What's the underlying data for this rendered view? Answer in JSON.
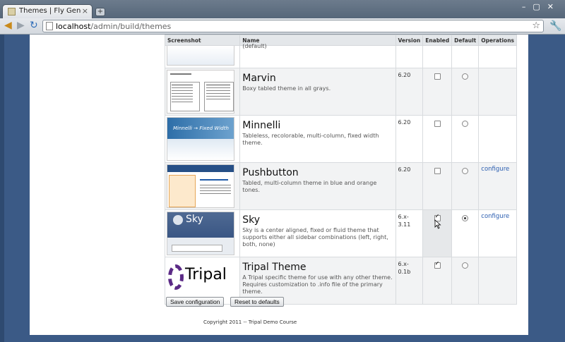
{
  "browser": {
    "tab_title": "Themes | Fly Genes D...",
    "tab_close": "×",
    "new_tab": "+",
    "url_host": "localhost",
    "url_path": "/admin/build/themes"
  },
  "table": {
    "headers": [
      "Screenshot",
      "Name",
      "Version",
      "Enabled",
      "Default",
      "Operations"
    ],
    "top_partial_text": "(default)",
    "rows": [
      {
        "name": "Marvin",
        "desc": "Boxy tabled theme in all grays.",
        "version": "6.20",
        "enabled": false,
        "default": false,
        "op": ""
      },
      {
        "name": "Minnelli",
        "desc": "Tableless, recolorable, multi-column, fixed width theme.",
        "version": "6.20",
        "enabled": false,
        "default": false,
        "op": "",
        "shot_text": "Minnelli → Fixed Width"
      },
      {
        "name": "Pushbutton",
        "desc": "Tabled, multi-column theme in blue and orange tones.",
        "version": "6.20",
        "enabled": false,
        "default": false,
        "op": "configure"
      },
      {
        "name": "Sky",
        "desc": "Sky is a center aligned, fixed or fluid theme that supports either all sidebar combinations (left, right, both, none)",
        "version": "6.x-3.11",
        "enabled": true,
        "default": true,
        "op": "configure",
        "shot_text": "Sky"
      },
      {
        "name": "Tripal Theme",
        "desc": "A Tripal specific theme for use with any other theme. Requires customization to .info file of the primary theme.",
        "version": "6.x-0.1b",
        "enabled": true,
        "default": false,
        "op": "",
        "shot_text": "Tripal"
      }
    ]
  },
  "buttons": {
    "save": "Save configuration",
    "reset": "Reset to defaults"
  },
  "footer": "Copyright 2011 -- Tripal Demo Course"
}
